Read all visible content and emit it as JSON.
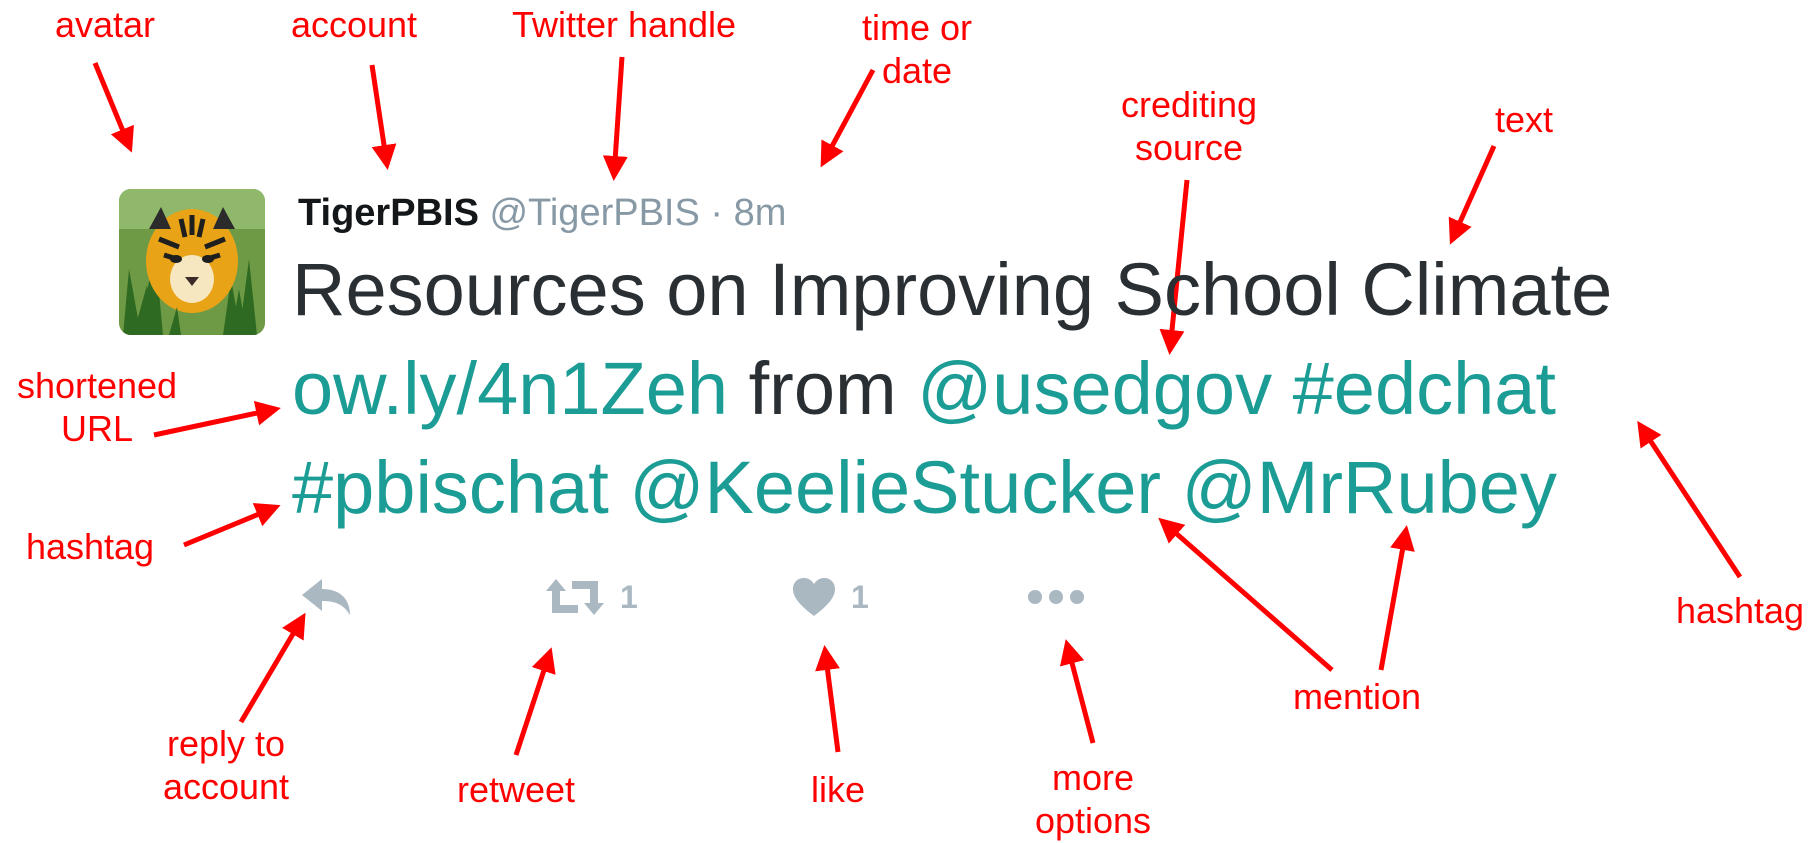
{
  "tweet": {
    "account_name": "TigerPBIS",
    "handle": "@TigerPBIS",
    "separator": "·",
    "time": "8m",
    "text_line1": "Resources on Improving School Climate",
    "url": "ow.ly/4n1Zeh",
    "from_word": "from",
    "source_mention": "@usedgov",
    "hashtag1": "#edchat",
    "hashtag2": "#pbischat",
    "mention1": "@KeelieStucker",
    "mention2": "@MrRubey",
    "retweet_count": "1",
    "like_count": "1",
    "colors": {
      "link": "#1b9c95",
      "text": "#292f33",
      "meta": "#8899a6",
      "action": "#aab8c2",
      "annotation": "#ff0000"
    }
  },
  "annotations": {
    "avatar": "avatar",
    "account": "account",
    "twitter_handle": "Twitter handle",
    "time_or_date": "time or\ndate",
    "crediting_source": "crediting\nsource",
    "text": "text",
    "shortened_url": "shortened\nURL",
    "hashtag_left": "hashtag",
    "hashtag_right": "hashtag",
    "mention": "mention",
    "reply_to_account": "reply to\naccount",
    "retweet": "retweet",
    "like": "like",
    "more_options": "more\noptions"
  },
  "icons": {
    "reply": "reply-icon",
    "retweet": "retweet-icon",
    "like": "heart-icon",
    "more": "more-options-icon",
    "avatar": "tiger-avatar"
  }
}
